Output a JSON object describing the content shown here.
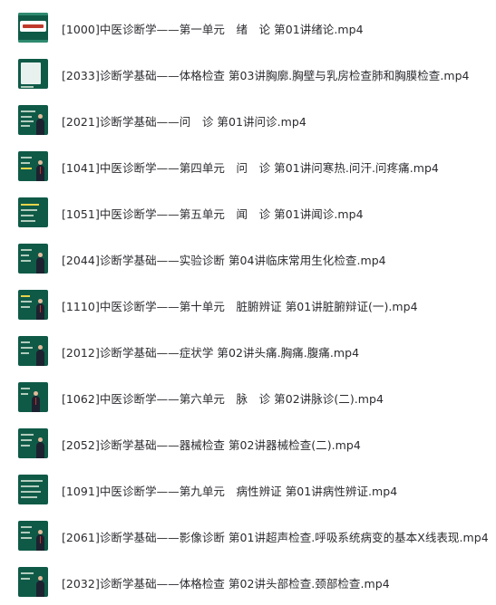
{
  "files": [
    {
      "name": "[1000]中医诊断学——第一单元　绪　论 第01讲绪论.mp4"
    },
    {
      "name": "[2033]诊断学基础——体格检查 第03讲胸廓.胸壁与乳房检查肺和胸膜检查.mp4"
    },
    {
      "name": "[2021]诊断学基础——问　诊 第01讲问诊.mp4"
    },
    {
      "name": "[1041]中医诊断学——第四单元　问　诊 第01讲问寒热.问汗.问疼痛.mp4"
    },
    {
      "name": "[1051]中医诊断学——第五单元　闻　诊 第01讲闻诊.mp4"
    },
    {
      "name": "[2044]诊断学基础——实验诊断 第04讲临床常用生化检查.mp4"
    },
    {
      "name": "[1110]中医诊断学——第十单元　脏腑辨证 第01讲脏腑辩证(一).mp4"
    },
    {
      "name": "[2012]诊断学基础——症状学 第02讲头痛.胸痛.腹痛.mp4"
    },
    {
      "name": "[1062]中医诊断学——第六单元　脉　诊 第02讲脉诊(二).mp4"
    },
    {
      "name": "[2052]诊断学基础——器械检查 第02讲器械检查(二).mp4"
    },
    {
      "name": "[1091]中医诊断学——第九单元　病性辨证 第01讲病性辨证.mp4"
    },
    {
      "name": "[2061]诊断学基础——影像诊断 第01讲超声检查.呼吸系统病变的基本X线表现.mp4"
    },
    {
      "name": "[2032]诊断学基础——体格检查 第02讲头部检查.颈部检查.mp4"
    }
  ]
}
